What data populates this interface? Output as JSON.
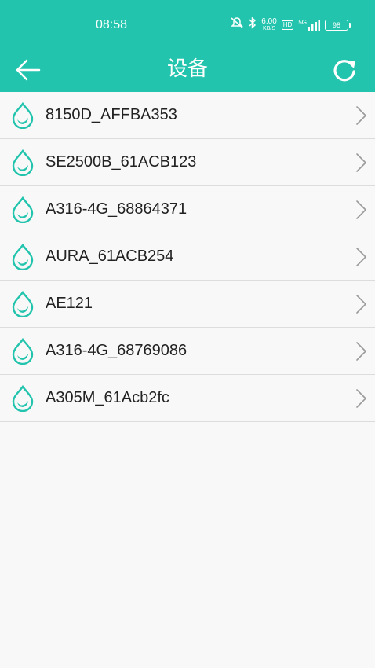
{
  "status_bar": {
    "time": "08:58",
    "net_speed_value": "6.00",
    "net_speed_unit": "KB/S",
    "hd_label": "HD",
    "signal_label": "5G",
    "battery": "98"
  },
  "header": {
    "title": "设备",
    "background_color": "#22c4ad"
  },
  "devices": [
    {
      "label": "8150D_AFFBA353"
    },
    {
      "label": "SE2500B_61ACB123"
    },
    {
      "label": "A316-4G_68864371"
    },
    {
      "label": "AURA_61ACB254"
    },
    {
      "label": "AE121"
    },
    {
      "label": "A316-4G_68769086"
    },
    {
      "label": "A305M_61Acb2fc"
    }
  ],
  "icons": {
    "back": "arrow-left-icon",
    "refresh": "refresh-icon",
    "device": "water-drop-icon",
    "row_action": "chevron-right-icon"
  }
}
